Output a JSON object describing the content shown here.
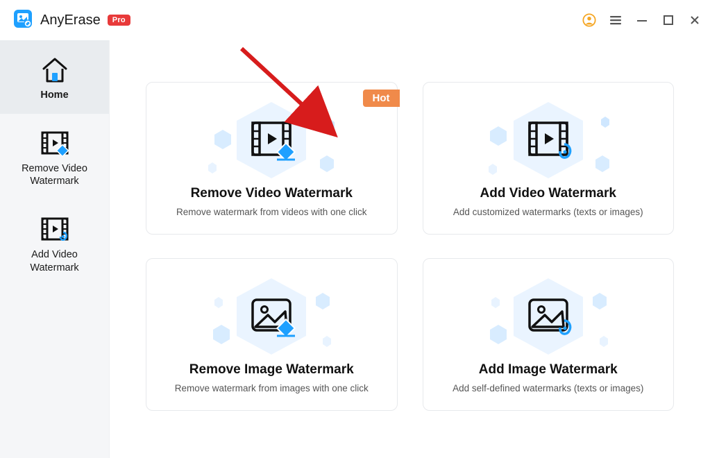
{
  "app": {
    "name": "AnyErase",
    "badge": "Pro"
  },
  "sidebar": {
    "items": [
      {
        "label": "Home"
      },
      {
        "label": "Remove Video Watermark"
      },
      {
        "label": "Add Video Watermark"
      }
    ],
    "activeIndex": 0
  },
  "cards": [
    {
      "title": "Remove Video Watermark",
      "subtitle": "Remove watermark from videos with one click",
      "badge": "Hot"
    },
    {
      "title": "Add Video Watermark",
      "subtitle": "Add customized watermarks (texts or images)"
    },
    {
      "title": "Remove Image Watermark",
      "subtitle": "Remove watermark from images with one click"
    },
    {
      "title": "Add Image Watermark",
      "subtitle": "Add self-defined watermarks  (texts or images)"
    }
  ],
  "colors": {
    "accent": "#1ea0ff",
    "badgeRed": "#e83a3a",
    "hot": "#f08a4a",
    "userRing": "#f5a623"
  },
  "annotation": {
    "arrowColor": "#d71c1c"
  }
}
